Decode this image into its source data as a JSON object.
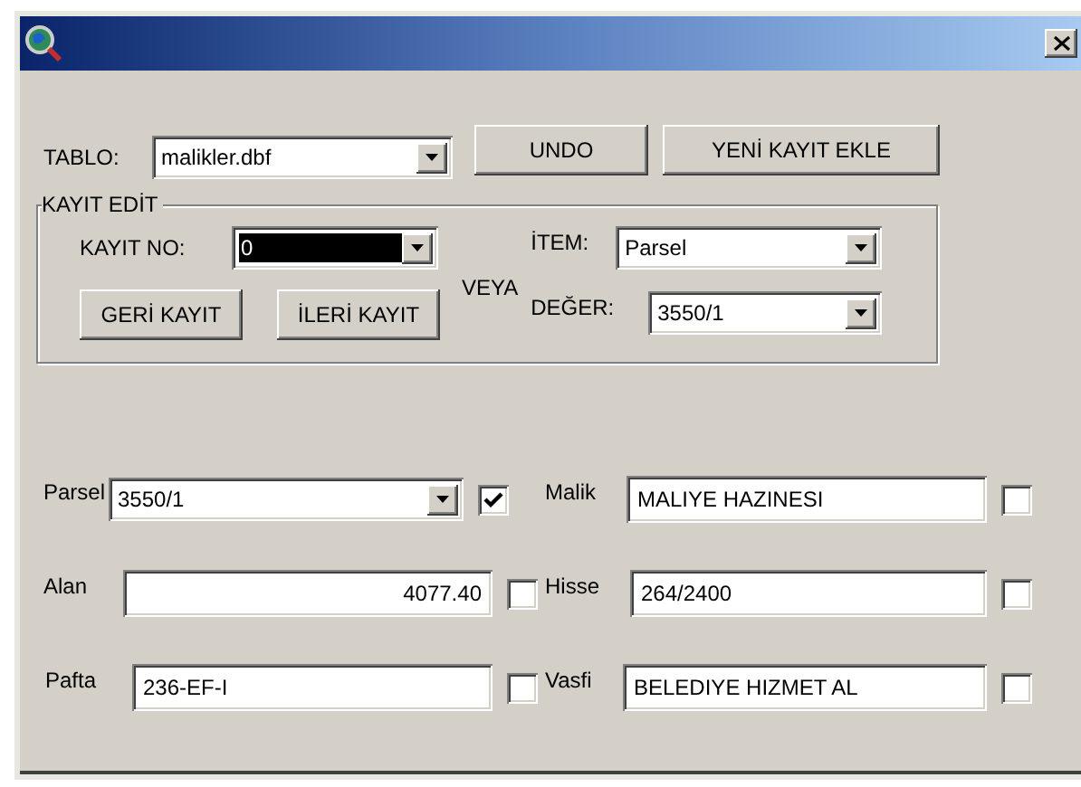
{
  "table_select": {
    "label": "TABLO:",
    "value": "malikler.dbf"
  },
  "buttons": [
    "UNDO",
    "YENİ KAYIT EKLE"
  ],
  "record_edit": {
    "title": "KAYIT EDİT",
    "record_no": {
      "label": "KAYIT NO:",
      "value": "0",
      "selected": true
    },
    "nav_buttons": [
      "GERİ KAYIT",
      "İLERİ KAYIT"
    ],
    "or_label": "VEYA",
    "item": {
      "label": "İTEM:",
      "value": "Parsel"
    },
    "value_field": {
      "label": "DEĞER:",
      "value": "3550/1"
    }
  },
  "fields": [
    {
      "label": "Parsel",
      "value": "3550/1",
      "kind": "combo",
      "checked": true
    },
    {
      "label": "Malik",
      "value": "MALIYE HAZINESI",
      "kind": "text",
      "checked": false
    },
    {
      "label": "Alan",
      "value": "4077.40",
      "kind": "number",
      "checked": false
    },
    {
      "label": "Hisse",
      "value": "264/2400",
      "kind": "text",
      "checked": false
    },
    {
      "label": "Pafta",
      "value": "236-EF-I",
      "kind": "text",
      "checked": false
    },
    {
      "label": "Vasfi",
      "value": "BELEDIYE HIZMET AL",
      "kind": "text",
      "checked": false
    }
  ]
}
